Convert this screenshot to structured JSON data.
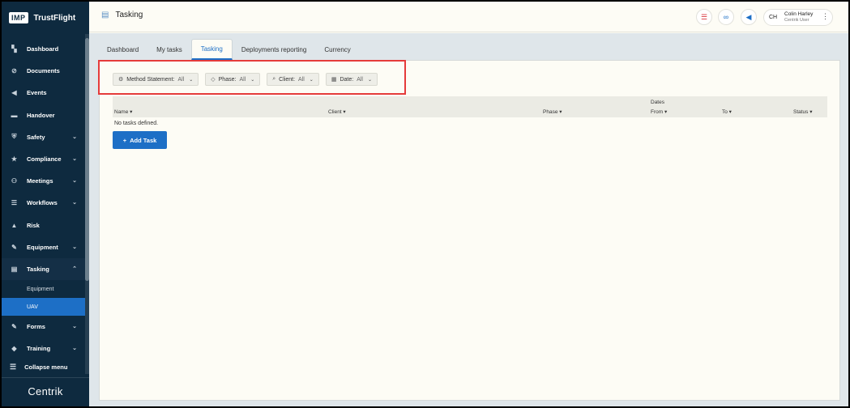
{
  "brand": {
    "logo": "IMP",
    "name": "TrustFlight"
  },
  "sidebar": {
    "items": [
      {
        "label": "Dashboard",
        "icon": "dashboard-icon",
        "glyph": "▚",
        "chevron": ""
      },
      {
        "label": "Documents",
        "icon": "paperclip-icon",
        "glyph": "⊘",
        "chevron": ""
      },
      {
        "label": "Events",
        "icon": "megaphone-icon",
        "glyph": "◀",
        "chevron": ""
      },
      {
        "label": "Handover",
        "icon": "handover-icon",
        "glyph": "▬",
        "chevron": ""
      },
      {
        "label": "Safety",
        "icon": "shield-icon",
        "glyph": "⛨",
        "chevron": "⌄"
      },
      {
        "label": "Compliance",
        "icon": "compliance-icon",
        "glyph": "★",
        "chevron": "⌄"
      },
      {
        "label": "Meetings",
        "icon": "meetings-icon",
        "glyph": "⚇",
        "chevron": "⌄"
      },
      {
        "label": "Workflows",
        "icon": "workflows-icon",
        "glyph": "☰",
        "chevron": "⌄"
      },
      {
        "label": "Risk",
        "icon": "warning-icon",
        "glyph": "▲",
        "chevron": ""
      },
      {
        "label": "Equipment",
        "icon": "wrench-icon",
        "glyph": "✎",
        "chevron": "⌄"
      },
      {
        "label": "Tasking",
        "icon": "clipboard-icon",
        "glyph": "▤",
        "chevron": "⌃"
      }
    ],
    "tasking_sub": [
      {
        "label": "Equipment"
      },
      {
        "label": "UAV"
      }
    ],
    "items_after": [
      {
        "label": "Forms",
        "icon": "forms-icon",
        "glyph": "✎",
        "chevron": "⌄"
      },
      {
        "label": "Training",
        "icon": "graduation-cap-icon",
        "glyph": "◆",
        "chevron": "⌄"
      }
    ],
    "collapse_label": "Collapse menu",
    "footer_logo": "Centrik"
  },
  "header": {
    "title": "Tasking",
    "user": {
      "initials": "CH",
      "name": "Colin Harley",
      "role": "Centrik User"
    }
  },
  "tabs": [
    {
      "label": "Dashboard",
      "active": false
    },
    {
      "label": "My tasks",
      "active": false
    },
    {
      "label": "Tasking",
      "active": true
    },
    {
      "label": "Deployments reporting",
      "active": false
    },
    {
      "label": "Currency",
      "active": false
    }
  ],
  "filters": [
    {
      "label": "Method Statement:",
      "value": "All",
      "icon": "method-statement-icon",
      "glyph": "⚙"
    },
    {
      "label": "Phase:",
      "value": "All",
      "icon": "tag-icon",
      "glyph": "◇"
    },
    {
      "label": "Client:",
      "value": "All",
      "icon": "search-icon",
      "glyph": "⌕"
    },
    {
      "label": "Date:",
      "value": "All",
      "icon": "calendar-icon",
      "glyph": "▦"
    }
  ],
  "table": {
    "group_header": "Dates",
    "columns": [
      "Name",
      "Client",
      "Phase",
      "From",
      "To",
      "Status"
    ],
    "empty_text": "No tasks defined."
  },
  "add_task_label": "Add Task",
  "colors": {
    "sidebar": "#0e2a3f",
    "accent": "#1d6fc6",
    "highlight": "#e53b3b"
  }
}
